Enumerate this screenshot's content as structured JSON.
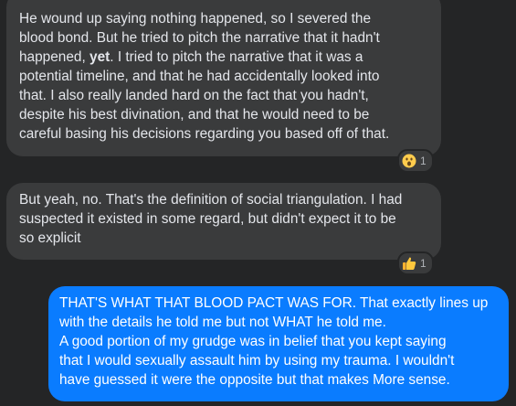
{
  "messages": [
    {
      "direction": "incoming",
      "lines": [
        "He wound up saying nothing happened, so I severed the",
        "blood bond. But he tried to pitch the narrative that it hadn't",
        [
          "happened, ",
          "yet",
          ". I tried to pitch the narrative that it was a"
        ],
        "potential timeline, and that he had accidentally looked into",
        "that. I also really landed hard on the fact that you hadn't,",
        "despite his best divination, and that he would need to be",
        "careful basing his decisions regarding you based off of that."
      ],
      "reaction": {
        "icon": "wow-emoji-icon",
        "count": "1"
      }
    },
    {
      "direction": "incoming",
      "lines": [
        "But yeah, no. That's the definition of social triangulation. I had",
        "suspected it existed in some regard, but didn't expect it to be",
        "so explicit"
      ],
      "reaction": {
        "icon": "thumbs-up-emoji-icon",
        "count": "1"
      }
    },
    {
      "direction": "outgoing",
      "lines": [
        "THAT'S WHAT THAT BLOOD PACT WAS FOR. That exactly lines up",
        "with the details he told me but not WHAT he told me.",
        "A good portion of my grudge was in belief that you kept saying",
        "that I would sexually assault him by using my trauma. I wouldn't",
        "have guessed it were the opposite but that makes More sense."
      ]
    }
  ],
  "colors": {
    "background": "#242526",
    "incoming_bubble": "#3a3b3c",
    "outgoing_bubble": "#0a7cff",
    "incoming_text": "#e4e6eb"
  }
}
